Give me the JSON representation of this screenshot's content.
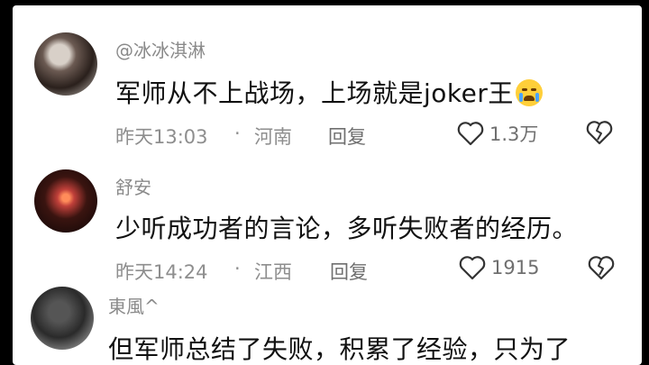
{
  "comments": [
    {
      "username": "@冰冰淇淋",
      "text": "军师从不上战场，上场就是joker王",
      "emoji": "loudly-crying-face",
      "time": "昨天13:03",
      "location": "河南",
      "reply_label": "回复",
      "likes": "1.3万"
    },
    {
      "username": "舒安",
      "text": "少听成功者的言论，多听失败者的经历。",
      "time": "昨天14:24",
      "location": "江西",
      "reply_label": "回复",
      "likes": "1915"
    },
    {
      "username": "東風^",
      "text": "但军师总结了失败，积累了经验，只为了"
    }
  ],
  "separator": "·",
  "colors": {
    "meta": "#8e8e8e",
    "text": "#111111",
    "background": "#ffffff"
  }
}
